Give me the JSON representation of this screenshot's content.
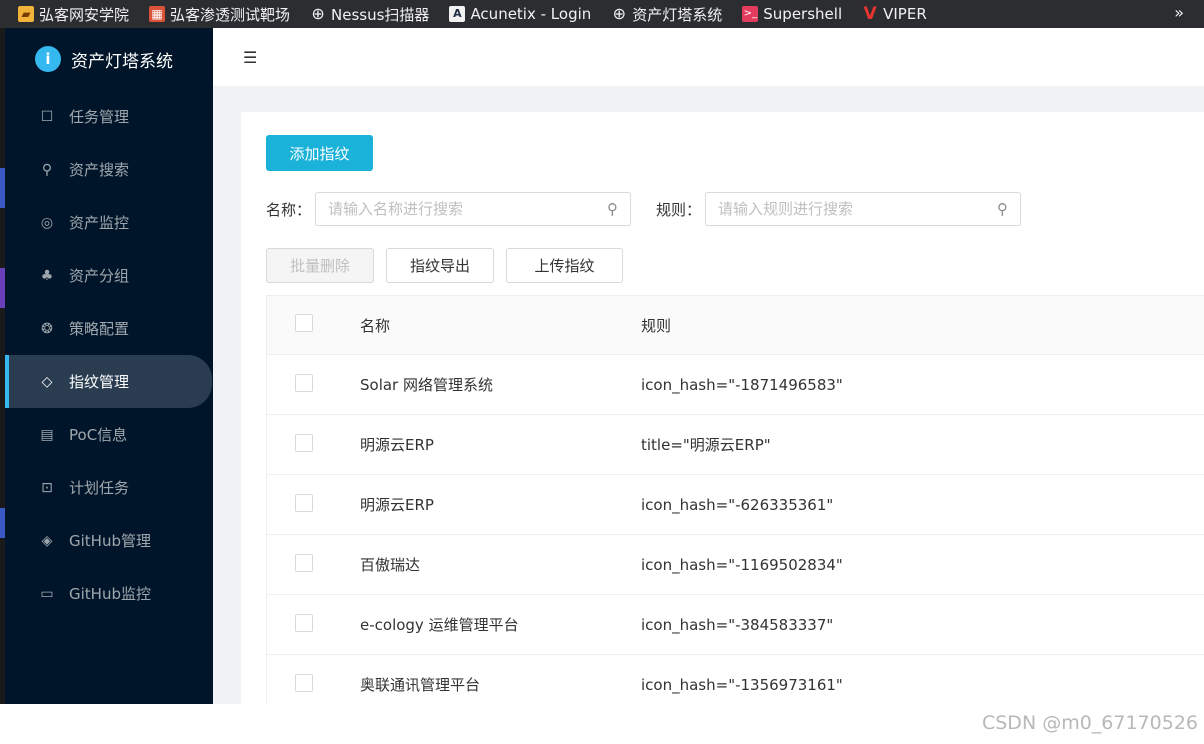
{
  "bookmarks": {
    "items": [
      {
        "label": "弘客网安学院",
        "icon": "folder-icon"
      },
      {
        "label": "弘客渗透测试靶场",
        "icon": "red-box-icon"
      },
      {
        "label": "Nessus扫描器",
        "icon": "globe-icon"
      },
      {
        "label": "Acunetix - Login",
        "icon": "acunetix-icon"
      },
      {
        "label": "资产灯塔系统",
        "icon": "globe-icon"
      },
      {
        "label": "Supershell",
        "icon": "terminal-icon"
      },
      {
        "label": "VIPER",
        "icon": "viper-icon"
      }
    ],
    "more": "»"
  },
  "sidebar": {
    "logo_text": "资产灯塔系统",
    "items": [
      {
        "label": "任务管理",
        "icon": "calendar-icon"
      },
      {
        "label": "资产搜索",
        "icon": "search-icon"
      },
      {
        "label": "资产监控",
        "icon": "monitor-icon"
      },
      {
        "label": "资产分组",
        "icon": "cluster-icon"
      },
      {
        "label": "策略配置",
        "icon": "strategy-icon"
      },
      {
        "label": "指纹管理",
        "icon": "tag-icon"
      },
      {
        "label": "PoC信息",
        "icon": "document-icon"
      },
      {
        "label": "计划任务",
        "icon": "terminal-icon"
      },
      {
        "label": "GitHub管理",
        "icon": "github-icon"
      },
      {
        "label": "GitHub监控",
        "icon": "laptop-icon"
      }
    ],
    "active_index": 5
  },
  "toolbar": {
    "add_label": "添加指纹",
    "batch_delete_label": "批量删除",
    "export_label": "指纹导出",
    "upload_label": "上传指纹"
  },
  "search": {
    "name_label": "名称：",
    "name_placeholder": "请输入名称进行搜索",
    "rule_label": "规则：",
    "rule_placeholder": "请输入规则进行搜索"
  },
  "table": {
    "columns": [
      "名称",
      "规则"
    ],
    "rows": [
      {
        "name": "Solar 网络管理系统",
        "rule": "icon_hash=\"-1871496583\""
      },
      {
        "name": "明源云ERP",
        "rule": "title=\"明源云ERP\""
      },
      {
        "name": "明源云ERP",
        "rule": "icon_hash=\"-626335361\""
      },
      {
        "name": "百傲瑞达",
        "rule": "icon_hash=\"-1169502834\""
      },
      {
        "name": "e-cology 运维管理平台",
        "rule": "icon_hash=\"-384583337\""
      },
      {
        "name": "奥联通讯管理平台",
        "rule": "icon_hash=\"-1356973161\""
      }
    ]
  },
  "watermark": "CSDN @m0_67170526",
  "colors": {
    "sidebar_bg": "#001529",
    "primary": "#1ab2d8",
    "accent": "#35b7f0"
  }
}
